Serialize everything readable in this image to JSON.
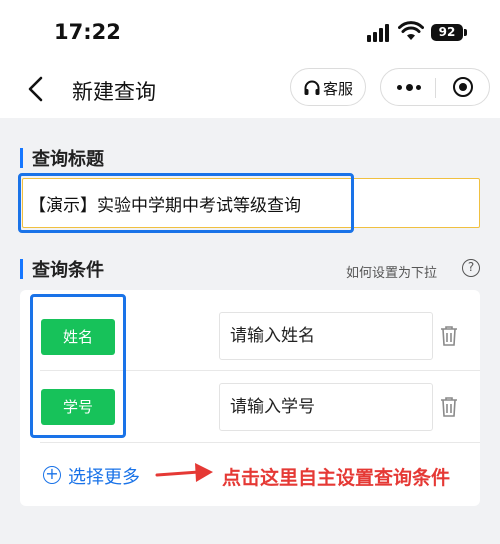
{
  "status_bar": {
    "time": "17:22",
    "battery": "92"
  },
  "nav": {
    "title": "新建查询",
    "service_label": "客服"
  },
  "title_section": {
    "label": "查询标题",
    "value": "【演示】实验中学期中考试等级查询"
  },
  "condition_section": {
    "label": "查询条件",
    "help_link": "如何设置为下拉",
    "help_icon_text": "?",
    "fields": [
      {
        "tag": "姓名",
        "placeholder": "请输入姓名"
      },
      {
        "tag": "学号",
        "placeholder": "请输入学号"
      }
    ],
    "add_more": "选择更多",
    "annotation": "点击这里自主设置查询条件"
  },
  "colors": {
    "accent": "#1677ff",
    "tag_green": "#17c25a",
    "annotation_red": "#e53935",
    "highlight_blue": "#1a73e8"
  },
  "icons": [
    "back-chevron-icon",
    "headphones-icon",
    "more-dots-icon",
    "close-target-icon",
    "trash-icon",
    "plus-circle-icon",
    "arrow-right-icon"
  ]
}
